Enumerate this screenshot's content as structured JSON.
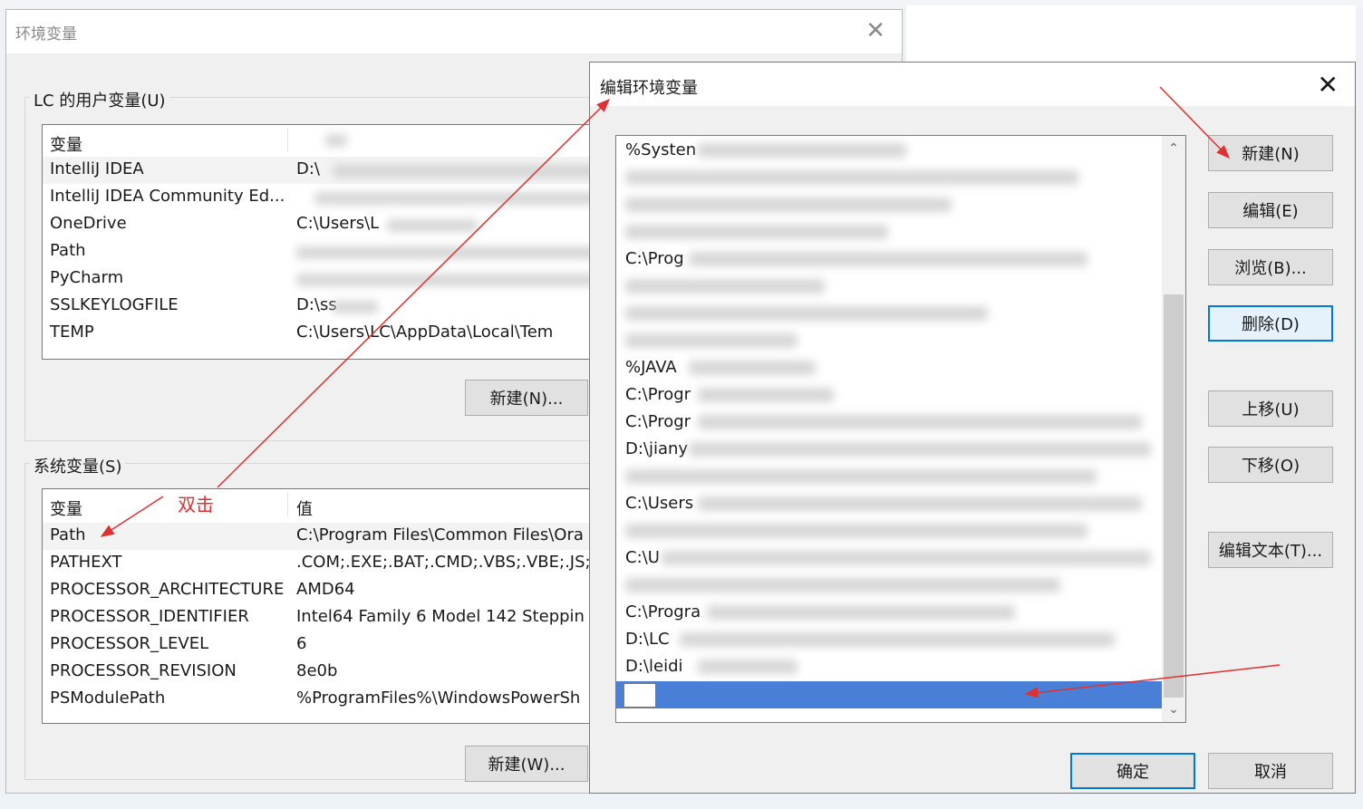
{
  "env_window": {
    "title": "环境变量",
    "close_glyph": "✕",
    "user_group": {
      "label": "LC 的用户变量(U)",
      "header": {
        "var": "变量",
        "val": ""
      },
      "rows": [
        {
          "name": "IntelliJ IDEA",
          "value": "D:\\"
        },
        {
          "name": "IntelliJ IDEA Community Ed...",
          "value": ""
        },
        {
          "name": "OneDrive",
          "value": "C:\\Users\\L"
        },
        {
          "name": "Path",
          "value": ""
        },
        {
          "name": "PyCharm",
          "value": ""
        },
        {
          "name": "SSLKEYLOGFILE",
          "value": "D:\\ss"
        },
        {
          "name": "TEMP",
          "value": "C:\\Users\\LC\\AppData\\Local\\Tem"
        }
      ],
      "new_button": "新建(N)..."
    },
    "system_group": {
      "label": "系统变量(S)",
      "header": {
        "var": "变量",
        "val": "值"
      },
      "rows": [
        {
          "name": "Path",
          "value": "C:\\Program Files\\Common Files\\Ora"
        },
        {
          "name": "PATHEXT",
          "value": ".COM;.EXE;.BAT;.CMD;.VBS;.VBE;.JS;."
        },
        {
          "name": "PROCESSOR_ARCHITECTURE",
          "value": "AMD64"
        },
        {
          "name": "PROCESSOR_IDENTIFIER",
          "value": "Intel64 Family 6 Model 142 Steppin"
        },
        {
          "name": "PROCESSOR_LEVEL",
          "value": "6"
        },
        {
          "name": "PROCESSOR_REVISION",
          "value": "8e0b"
        },
        {
          "name": "PSModulePath",
          "value": "%ProgramFiles%\\WindowsPowerSh"
        }
      ],
      "new_button": "新建(W)..."
    }
  },
  "edit_dialog": {
    "title": "编辑环境变量",
    "close_glyph": "✕",
    "paths": [
      "%Systen",
      "",
      "",
      "",
      "C:\\Prog",
      "",
      "",
      "",
      "%JAVA",
      "C:\\Progr",
      "C:\\Progr",
      "D:\\jiany",
      "",
      "C:\\Users",
      "",
      "C:\\U",
      "",
      "C:\\Progra",
      "D:\\LC",
      "D:\\leidi"
    ],
    "buttons": {
      "new": "新建(N)",
      "edit": "编辑(E)",
      "browse": "浏览(B)...",
      "delete": "删除(D)",
      "move_up": "上移(U)",
      "move_down": "下移(O)",
      "edit_text": "编辑文本(T)...",
      "ok": "确定",
      "cancel": "取消"
    },
    "scroll_up_glyph": "⌃",
    "scroll_down_glyph": "⌄"
  },
  "annotation": {
    "double_click": "双击",
    "color": "#e03030"
  }
}
